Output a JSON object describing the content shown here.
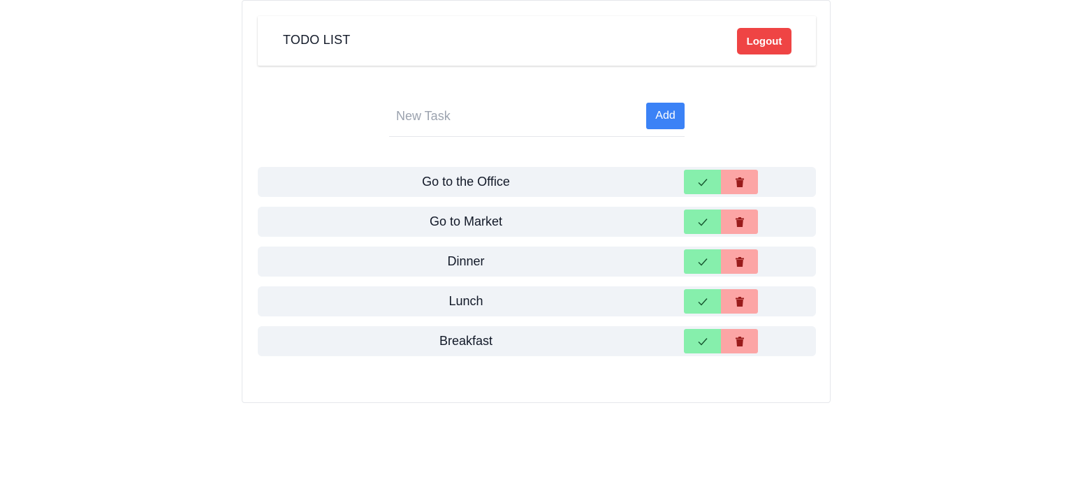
{
  "header": {
    "title": "TODO LIST",
    "logout_label": "Logout"
  },
  "form": {
    "placeholder": "New Task",
    "value": "",
    "add_label": "Add"
  },
  "tasks": [
    {
      "text": "Go to the Office"
    },
    {
      "text": "Go to Market"
    },
    {
      "text": "Dinner"
    },
    {
      "text": "Lunch"
    },
    {
      "text": "Breakfast"
    }
  ],
  "icons": {
    "done": "check-icon",
    "delete": "trash-icon"
  },
  "colors": {
    "logout": "#ef4444",
    "add": "#3b82f6",
    "done_bg": "#86efac",
    "delete_bg": "#fca5a5",
    "row_bg": "#f0f3f7"
  }
}
